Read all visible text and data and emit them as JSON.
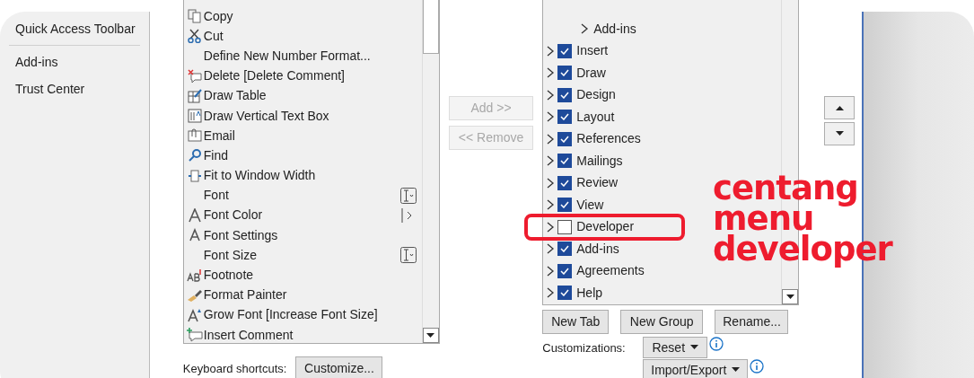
{
  "sidebar": {
    "items": [
      {
        "label": "Quick Access Toolbar",
        "selected": false
      },
      {
        "label": "Add-ins",
        "selected": false
      },
      {
        "label": "Trust Center",
        "selected": false
      }
    ]
  },
  "commands": [
    {
      "label": "Copy",
      "kind": "command"
    },
    {
      "label": "Cut",
      "kind": "command"
    },
    {
      "label": "Define New Number Format...",
      "kind": "command"
    },
    {
      "label": "Delete [Delete Comment]",
      "kind": "command"
    },
    {
      "label": "Draw Table",
      "kind": "command"
    },
    {
      "label": "Draw Vertical Text Box",
      "kind": "command"
    },
    {
      "label": "Email",
      "kind": "command"
    },
    {
      "label": "Find",
      "kind": "command"
    },
    {
      "label": "Fit to Window Width",
      "kind": "command"
    },
    {
      "label": "Font",
      "kind": "combo"
    },
    {
      "label": "Font Color",
      "kind": "split"
    },
    {
      "label": "Font Settings",
      "kind": "command"
    },
    {
      "label": "Font Size",
      "kind": "combo"
    },
    {
      "label": "Footnote",
      "kind": "command"
    },
    {
      "label": "Format Painter",
      "kind": "command"
    },
    {
      "label": "Grow Font [Increase Font Size]",
      "kind": "command"
    },
    {
      "label": "Insert Comment",
      "kind": "command"
    }
  ],
  "keyboard_shortcuts": {
    "label": "Keyboard shortcuts:",
    "button": "Customize..."
  },
  "add_button": {
    "label": "Add >>",
    "disabled": true
  },
  "remove_button": {
    "label": "<< Remove",
    "disabled": true
  },
  "ribbon_tabs": [
    {
      "label": "Add-ins",
      "kind": "group"
    },
    {
      "label": "Insert",
      "kind": "tab",
      "checked": true
    },
    {
      "label": "Draw",
      "kind": "tab",
      "checked": true
    },
    {
      "label": "Design",
      "kind": "tab",
      "checked": true
    },
    {
      "label": "Layout",
      "kind": "tab",
      "checked": true
    },
    {
      "label": "References",
      "kind": "tab",
      "checked": true
    },
    {
      "label": "Mailings",
      "kind": "tab",
      "checked": true
    },
    {
      "label": "Review",
      "kind": "tab",
      "checked": true
    },
    {
      "label": "View",
      "kind": "tab",
      "checked": true
    },
    {
      "label": "Developer",
      "kind": "tab",
      "checked": false
    },
    {
      "label": "Add-ins",
      "kind": "tab",
      "checked": true
    },
    {
      "label": "Agreements",
      "kind": "tab",
      "checked": true
    },
    {
      "label": "Help",
      "kind": "tab",
      "checked": true
    }
  ],
  "tab_buttons": [
    "New Tab",
    "New Group",
    "Rename..."
  ],
  "customizations": {
    "label": "Customizations:",
    "reset": "Reset",
    "import_export": "Import/Export"
  },
  "annotation": {
    "lines": [
      "centang",
      "menu",
      "developer"
    ]
  }
}
